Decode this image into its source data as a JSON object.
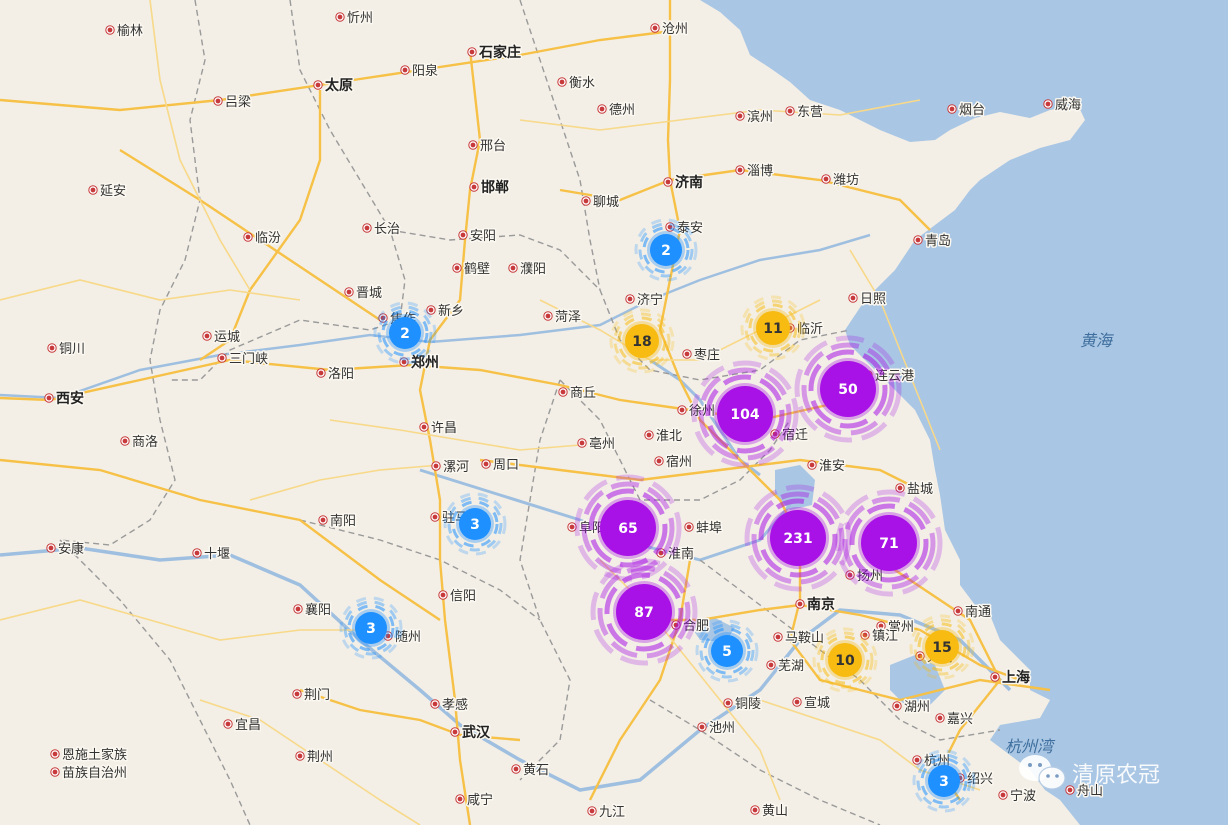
{
  "colors": {
    "land": "#f3efe6",
    "sea": "#a9c6e4",
    "road_major": "#f6c146",
    "road_minor": "#f8d989",
    "border": "#9a9a9a",
    "river": "#9fbfe0",
    "city_dot": "#c8393b",
    "cluster_blue": "#1e90ff",
    "cluster_yellow": "#f7bb12",
    "cluster_purple": "#a812e6"
  },
  "sea_labels": [
    {
      "name": "黄海"
    },
    {
      "name": "杭州湾"
    }
  ],
  "cities": [
    {
      "name": "榆林"
    },
    {
      "name": "忻州"
    },
    {
      "name": "沧州"
    },
    {
      "name": "石家庄"
    },
    {
      "name": "太原"
    },
    {
      "name": "阳泉"
    },
    {
      "name": "衡水"
    },
    {
      "name": "德州"
    },
    {
      "name": "吕梁"
    },
    {
      "name": "滨州"
    },
    {
      "name": "东营"
    },
    {
      "name": "烟台"
    },
    {
      "name": "威海"
    },
    {
      "name": "邢台"
    },
    {
      "name": "淄博"
    },
    {
      "name": "潍坊"
    },
    {
      "name": "延安"
    },
    {
      "name": "邯郸"
    },
    {
      "name": "济南"
    },
    {
      "name": "聊城"
    },
    {
      "name": "长治"
    },
    {
      "name": "临汾"
    },
    {
      "name": "安阳"
    },
    {
      "name": "泰安"
    },
    {
      "name": "青岛"
    },
    {
      "name": "鹤壁"
    },
    {
      "name": "濮阳"
    },
    {
      "name": "晋城"
    },
    {
      "name": "济宁"
    },
    {
      "name": "日照"
    },
    {
      "name": "新乡"
    },
    {
      "name": "焦作"
    },
    {
      "name": "菏泽"
    },
    {
      "name": "运城"
    },
    {
      "name": "临沂"
    },
    {
      "name": "铜川"
    },
    {
      "name": "三门峡"
    },
    {
      "name": "郑州"
    },
    {
      "name": "枣庄"
    },
    {
      "name": "洛阳"
    },
    {
      "name": "连云港"
    },
    {
      "name": "商丘"
    },
    {
      "name": "西安"
    },
    {
      "name": "徐州"
    },
    {
      "name": "许昌"
    },
    {
      "name": "淮北"
    },
    {
      "name": "宿迁"
    },
    {
      "name": "商洛"
    },
    {
      "name": "亳州"
    },
    {
      "name": "漯河"
    },
    {
      "name": "周口"
    },
    {
      "name": "宿州"
    },
    {
      "name": "淮安"
    },
    {
      "name": "盐城"
    },
    {
      "name": "南阳"
    },
    {
      "name": "驻马店"
    },
    {
      "name": "阜阳"
    },
    {
      "name": "蚌埠"
    },
    {
      "name": "安康"
    },
    {
      "name": "十堰"
    },
    {
      "name": "淮南"
    },
    {
      "name": "扬州"
    },
    {
      "name": "南京"
    },
    {
      "name": "信阳"
    },
    {
      "name": "合肥"
    },
    {
      "name": "南通"
    },
    {
      "name": "襄阳"
    },
    {
      "name": "随州"
    },
    {
      "name": "马鞍山"
    },
    {
      "name": "常州"
    },
    {
      "name": "芜湖"
    },
    {
      "name": "镇江"
    },
    {
      "name": "无锡"
    },
    {
      "name": "上海"
    },
    {
      "name": "荆门"
    },
    {
      "name": "铜陵"
    },
    {
      "name": "宣城"
    },
    {
      "name": "湖州"
    },
    {
      "name": "嘉兴"
    },
    {
      "name": "宜昌"
    },
    {
      "name": "孝感"
    },
    {
      "name": "武汉"
    },
    {
      "name": "池州"
    },
    {
      "name": "恩施土家族"
    },
    {
      "name": "苗族自治州"
    },
    {
      "name": "荆州"
    },
    {
      "name": "杭州"
    },
    {
      "name": "黄石"
    },
    {
      "name": "绍兴"
    },
    {
      "name": "宁波"
    },
    {
      "name": "舟山"
    },
    {
      "name": "咸宁"
    },
    {
      "name": "九江"
    },
    {
      "name": "黄山"
    }
  ],
  "clusters": [
    {
      "count": "2",
      "level": "blue"
    },
    {
      "count": "2",
      "level": "blue"
    },
    {
      "count": "18",
      "level": "yellow"
    },
    {
      "count": "11",
      "level": "yellow"
    },
    {
      "count": "50",
      "level": "purple"
    },
    {
      "count": "104",
      "level": "purple"
    },
    {
      "count": "3",
      "level": "blue"
    },
    {
      "count": "65",
      "level": "purple"
    },
    {
      "count": "231",
      "level": "purple"
    },
    {
      "count": "71",
      "level": "purple"
    },
    {
      "count": "87",
      "level": "purple"
    },
    {
      "count": "3",
      "level": "blue"
    },
    {
      "count": "5",
      "level": "blue"
    },
    {
      "count": "10",
      "level": "yellow"
    },
    {
      "count": "15",
      "level": "yellow"
    },
    {
      "count": "3",
      "level": "blue"
    }
  ],
  "watermark": {
    "text": "清原农冠"
  }
}
